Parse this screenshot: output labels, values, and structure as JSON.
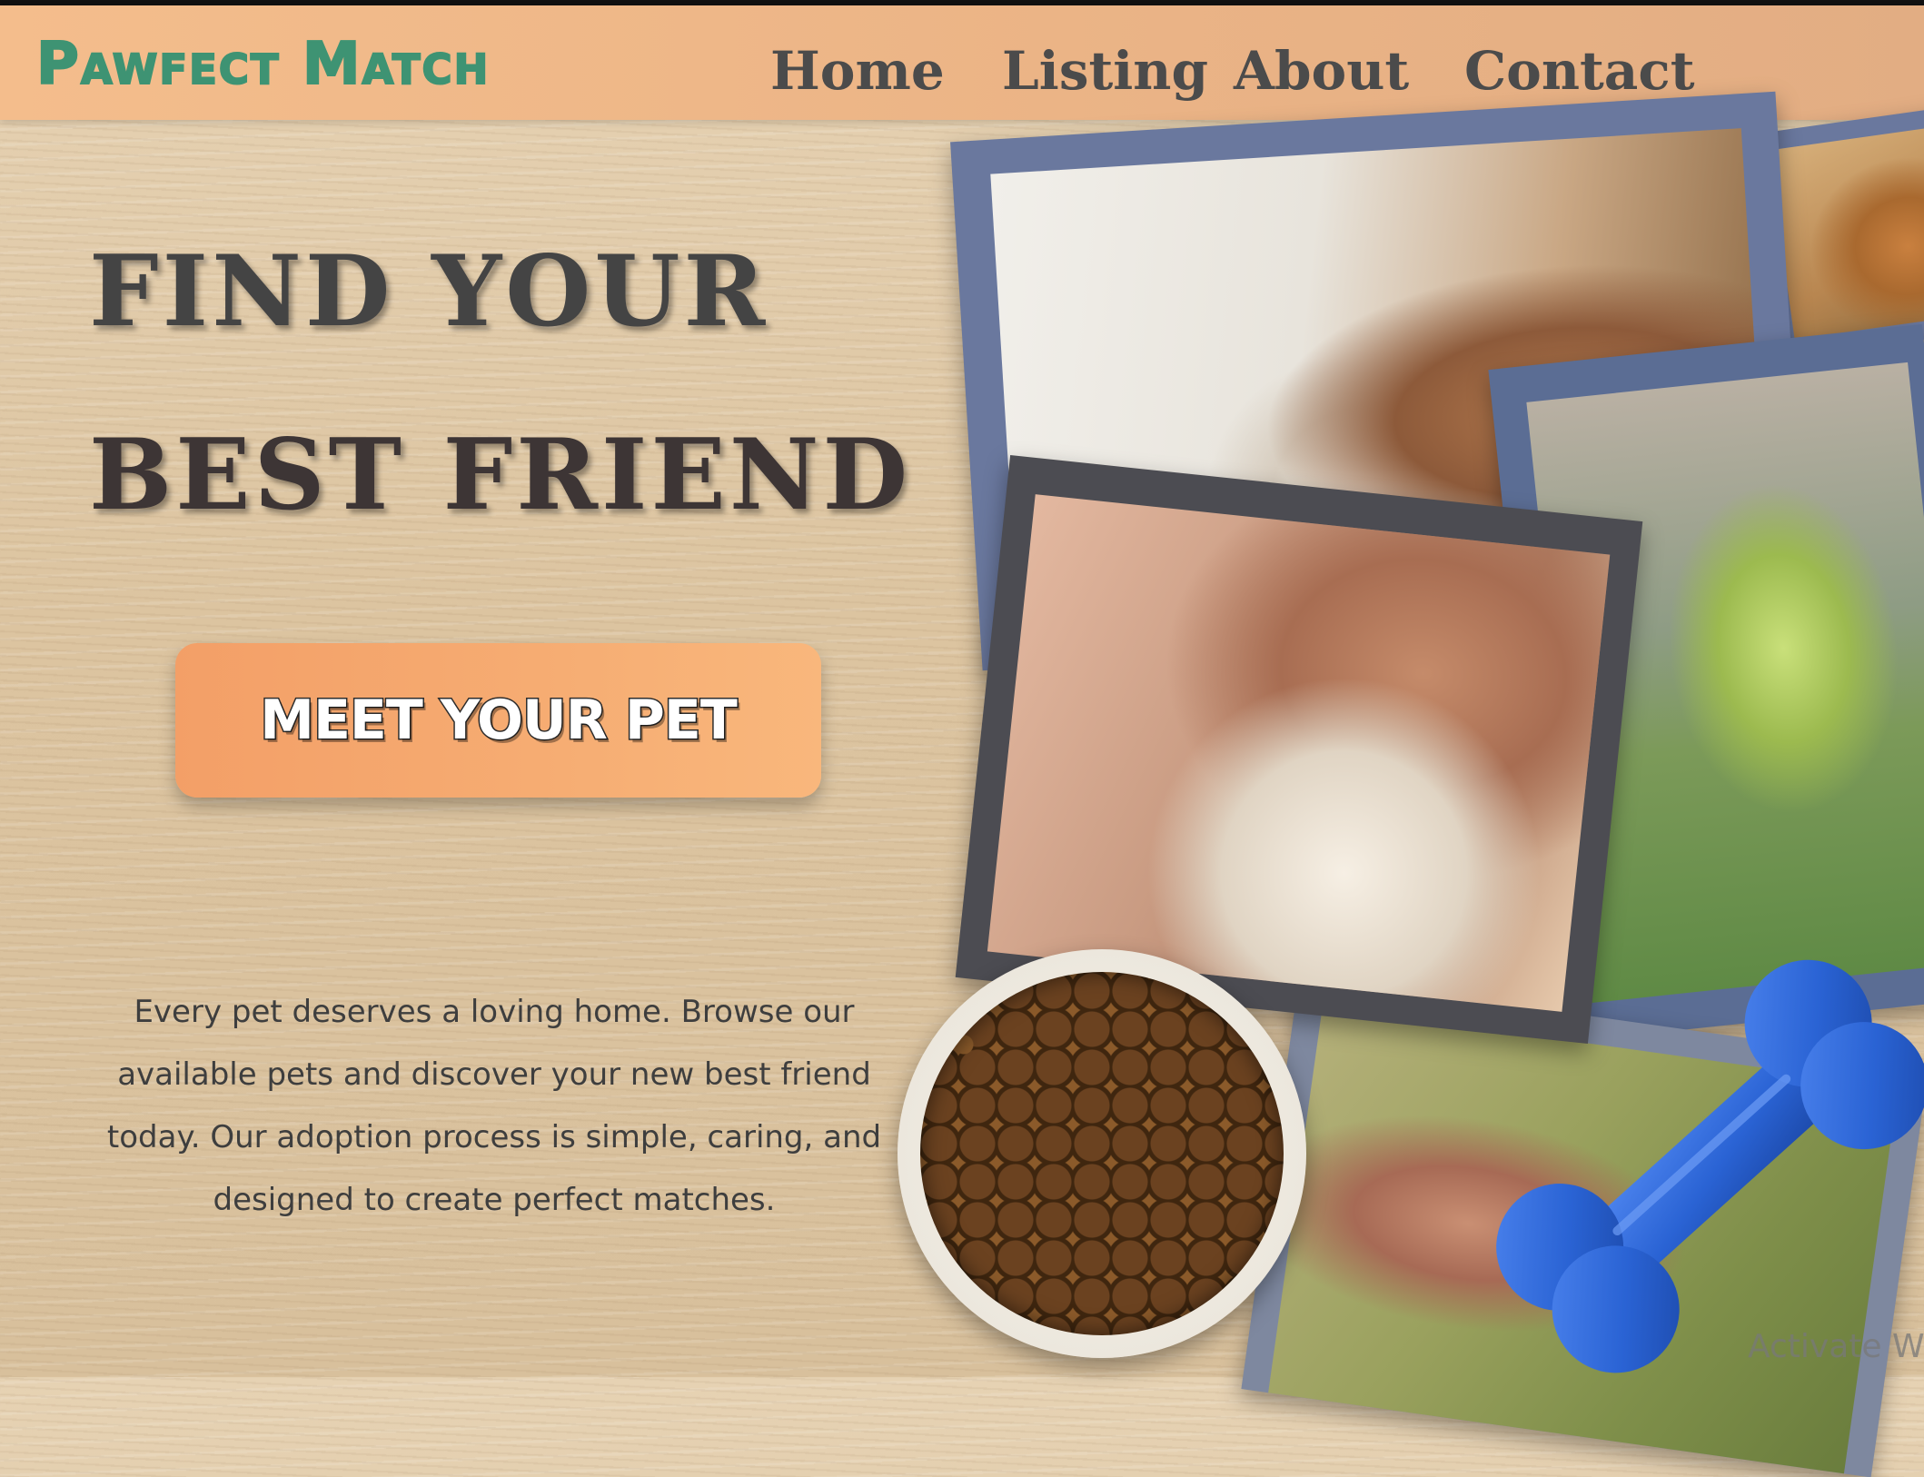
{
  "brand": {
    "logo_text": "Pawfect Match",
    "accent_color": "#3e9373"
  },
  "nav": {
    "items": [
      {
        "label": "Home"
      },
      {
        "label": "Listing"
      },
      {
        "label": "About"
      },
      {
        "label": "Contact"
      }
    ]
  },
  "hero": {
    "headline_line1": "FIND YOUR",
    "headline_line2": "BEST FRIEND",
    "cta_label": "MEET YOUR PET",
    "cta_color": "#f6ad73",
    "description": "Every pet deserves a loving home. Browse our available pets and discover your new best friend today. Our adoption process is simple, caring, and designed to create perfect matches."
  },
  "collage": {
    "icons": [
      "pet-food-bowl-icon",
      "dog-bone-toy-icon"
    ],
    "bone_color": "#2a63d4"
  },
  "watermark": {
    "text": "Activate W"
  }
}
